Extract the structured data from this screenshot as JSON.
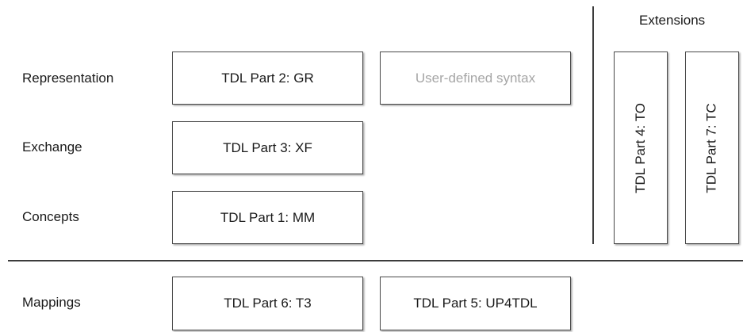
{
  "extensions_title": "Extensions",
  "rows": {
    "representation": "Representation",
    "exchange": "Exchange",
    "concepts": "Concepts",
    "mappings": "Mappings"
  },
  "boxes": {
    "gr": "TDL Part 2: GR",
    "user_syntax": "User-defined syntax",
    "xf": "TDL Part 3: XF",
    "mm": "TDL Part 1: MM",
    "to": "TDL Part 4: TO",
    "tc": "TDL Part 7: TC",
    "t3": "TDL Part 6: T3",
    "up4tdl": "TDL Part 5: UP4TDL"
  },
  "colors": {
    "border": "#4a4a4a",
    "text": "#1a1a1a",
    "muted_text": "#a6a6a6",
    "line": "#3c3c3c"
  }
}
